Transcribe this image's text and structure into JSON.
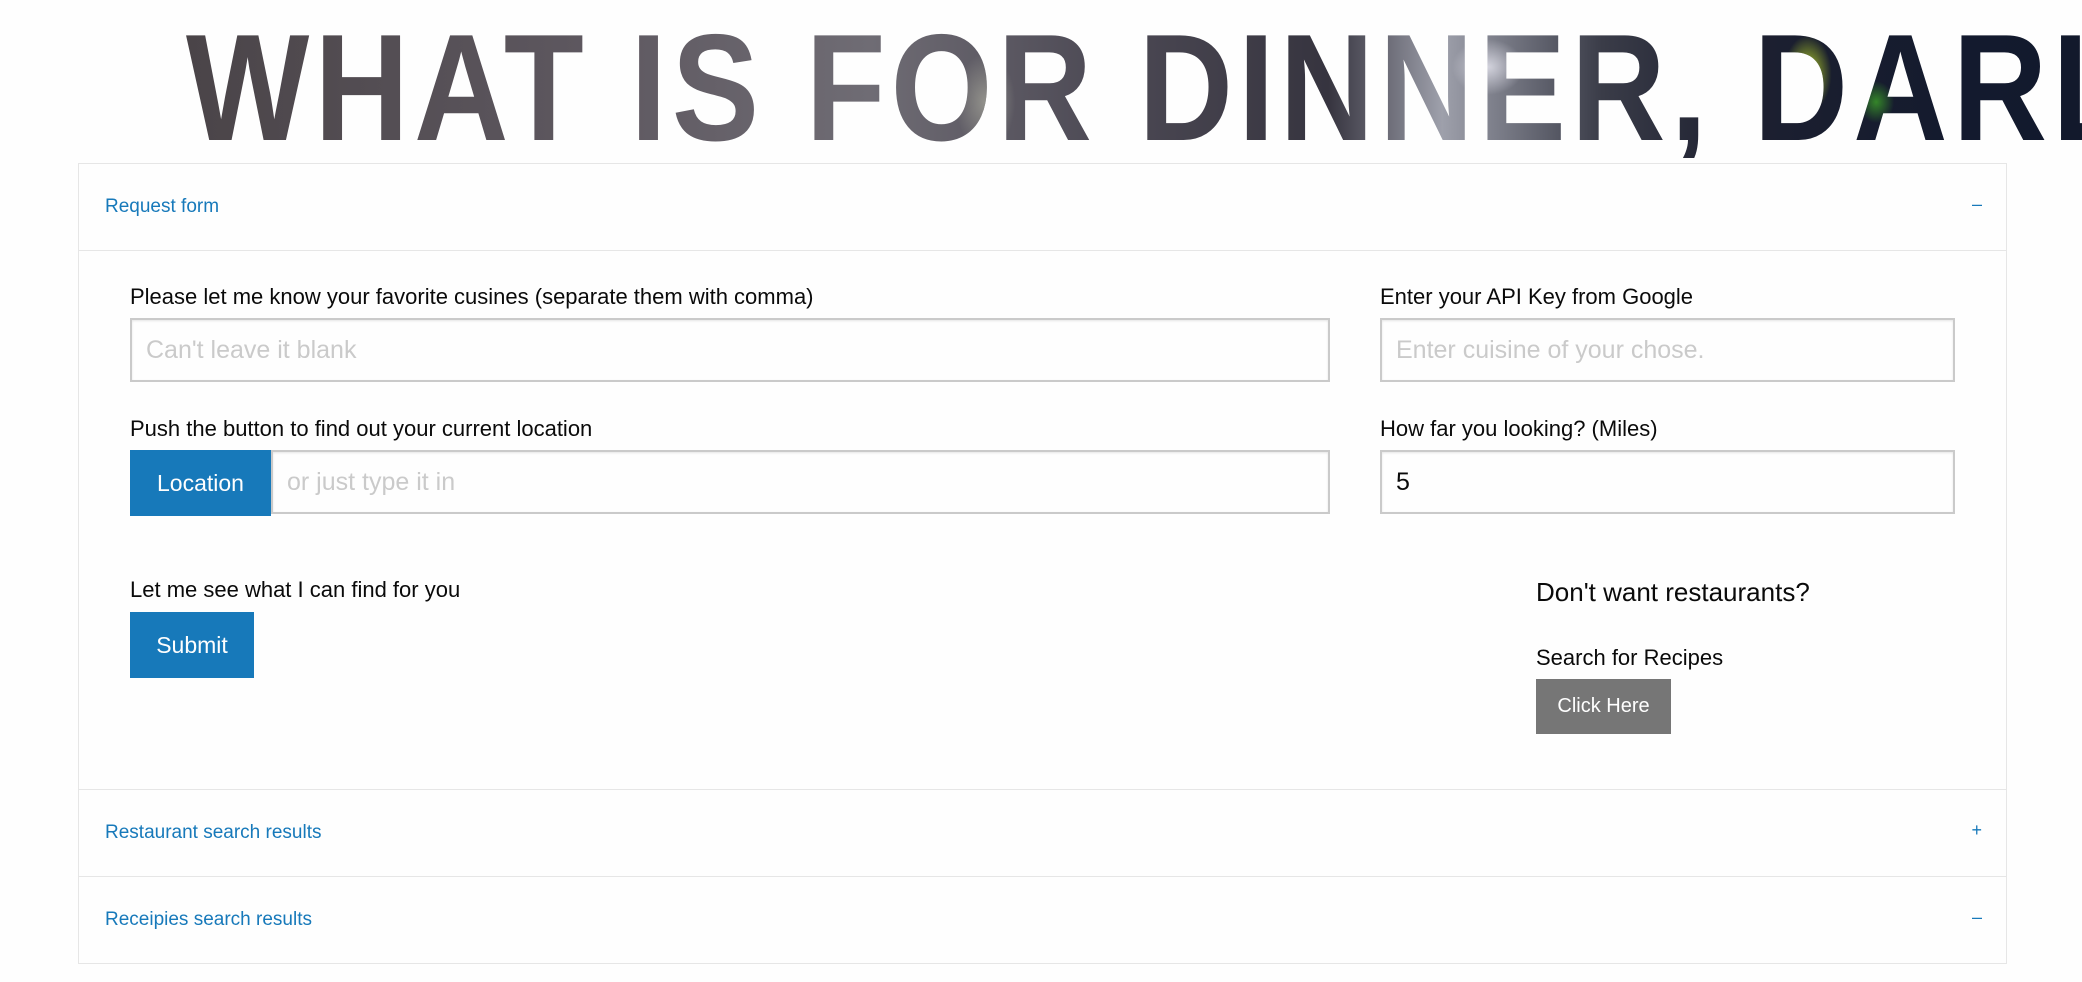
{
  "banner": {
    "title": "WHAT IS FOR DINNER, DARLING?"
  },
  "accordion": {
    "request_form": {
      "title": "Request form",
      "sign": "–"
    },
    "restaurant_results": {
      "title": "Restaurant search results",
      "sign": "+"
    },
    "recipe_results": {
      "title": "Receipies search results",
      "sign": "–"
    }
  },
  "form": {
    "cuisines": {
      "label": "Please let me know your favorite cusines (separate them with comma)",
      "placeholder": "Can't leave it blank",
      "value": ""
    },
    "api_key": {
      "label": "Enter your API Key from Google",
      "placeholder": "Enter cuisine of your chose.",
      "value": ""
    },
    "location": {
      "label": "Push the button to find out your current location",
      "button_label": "Location",
      "placeholder": "or just type it in",
      "value": ""
    },
    "distance": {
      "label": "How far you looking? (Miles)",
      "value": "5"
    },
    "submit": {
      "label": "Let me see what I can find for you",
      "button_label": "Submit"
    },
    "recipes": {
      "heading": "Don't want restaurants?",
      "label": "Search for Recipes",
      "button_label": "Click Here"
    }
  },
  "colors": {
    "accent": "#1779ba",
    "secondary_button": "#767676",
    "input_border": "#cacaca",
    "placeholder": "#cacaca",
    "divider": "#e6e6e6"
  }
}
